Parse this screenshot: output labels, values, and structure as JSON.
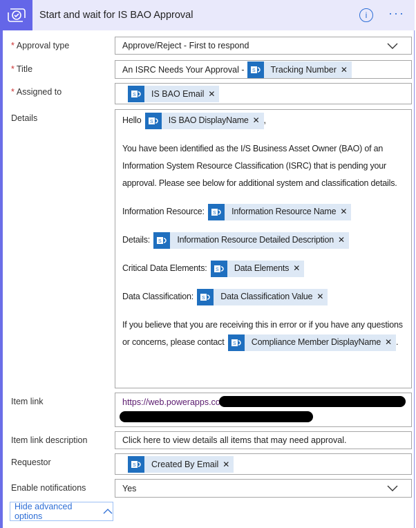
{
  "header": {
    "title": "Start and wait for IS BAO Approval",
    "icon": "approval-icon"
  },
  "fields": {
    "approval_type": {
      "label": "Approval type",
      "value": "Approve/Reject - First to respond"
    },
    "title": {
      "label": "Title",
      "prefix": "An ISRC Needs Your Approval -",
      "token": "Tracking Number"
    },
    "assigned_to": {
      "label": "Assigned to",
      "token": "IS BAO Email"
    },
    "details": {
      "label": "Details",
      "hello": "Hello",
      "hello_token": "IS BAO DisplayName",
      "hello_suffix": ",",
      "para1": "You have been identified as the I/S Business Asset Owner (BAO) of an Information System Resource Classification (ISRC) that is pending your approval. Please see below for additional system and classification details.",
      "l1": "Information Resource:",
      "t1": "Information Resource Name",
      "l2": "Details:",
      "t2": "Information Resource Detailed Description",
      "l3": "Critical Data Elements:",
      "t3": "Data Elements",
      "l4": "Data Classification:",
      "t4": "Data Classification Value",
      "para2": "If you believe that you are receiving this in error or if you have any questions or concerns, please contact",
      "t5": "Compliance Member DisplayName",
      "suffix2": "."
    },
    "item_link": {
      "label": "Item link",
      "value": "https://web.powerapps.com/"
    },
    "item_link_description": {
      "label": "Item link description",
      "value": "Click here to view details all items that may need approval."
    },
    "requestor": {
      "label": "Requestor",
      "token": "Created By Email"
    },
    "enable_notifications": {
      "label": "Enable notifications",
      "value": "Yes"
    }
  },
  "hide_advanced": "Hide advanced options",
  "colors": {
    "accent": "#6466e8",
    "link": "#2d6ed6",
    "sharepoint": "#1f6fbf",
    "chip": "#dde8f5"
  }
}
